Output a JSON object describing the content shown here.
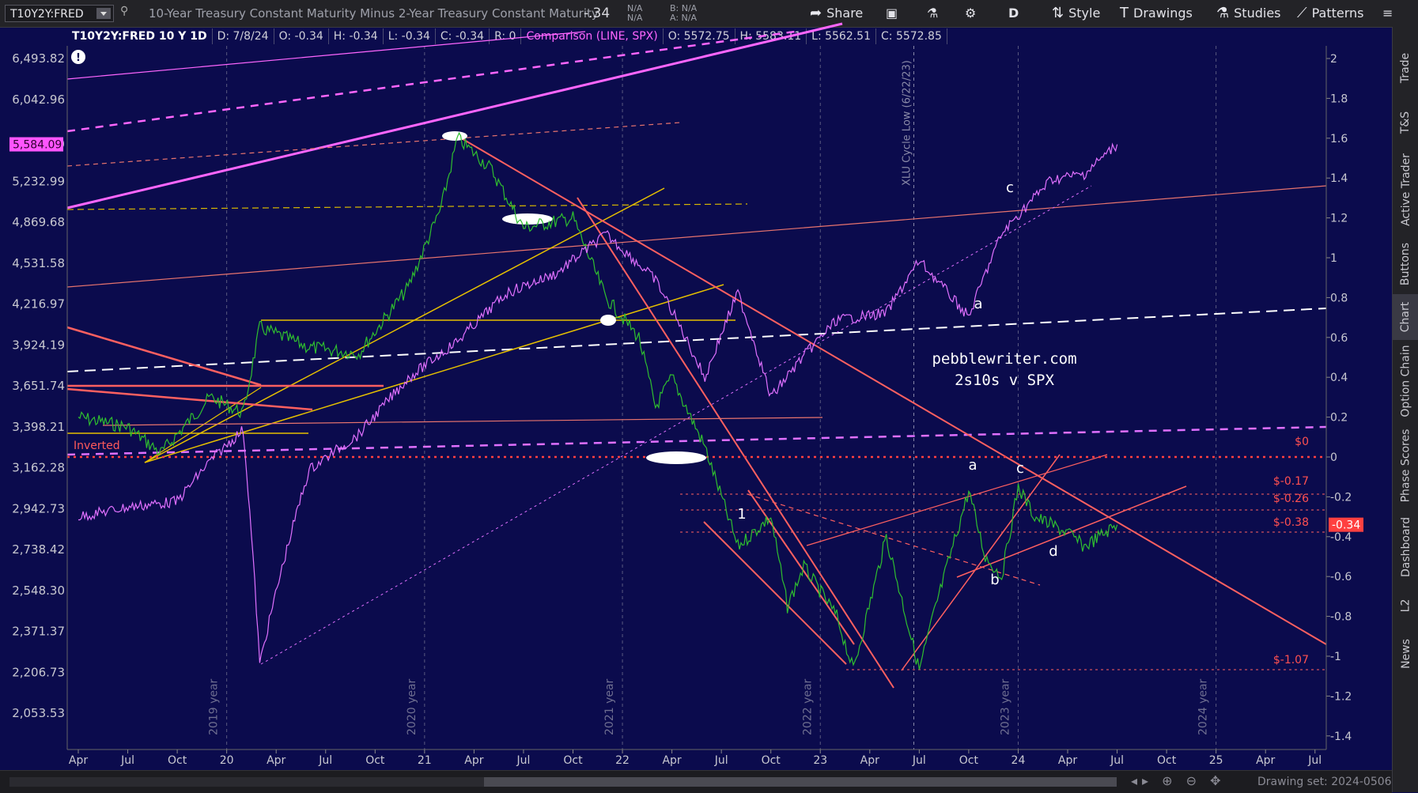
{
  "toolbar": {
    "symbol": "T10Y2Y:FRED",
    "description": "10-Year Treasury Constant Maturity Minus 2-Year Treasury Constant Maturity",
    "change": "-.34",
    "bid_na": "N/A",
    "ask_na": "N/A",
    "bid_label": "B: N/A",
    "ask_label": "A: N/A",
    "share": "Share",
    "timeframe": "D",
    "style": "Style",
    "drawings": "Drawings",
    "studies": "Studies",
    "patterns": "Patterns"
  },
  "legend": {
    "symbol": "T10Y2Y:FRED 10 Y 1D",
    "date": "D: 7/8/24",
    "open": "O: -0.34",
    "high": "H: -0.34",
    "low": "L: -0.34",
    "close": "C: -0.34",
    "r": "R: 0",
    "comparison": "Comparison (LINE, SPX)",
    "cmp_open": "O: 5572.75",
    "cmp_high": "H: 5583.11",
    "cmp_low": "L: 5562.51",
    "cmp_close": "C: 5572.85"
  },
  "sidebar_tabs": [
    "Trade",
    "T&S",
    "Active Trader",
    "Buttons",
    "Chart",
    "Option Chain",
    "Phase Scores",
    "Dashboard",
    "L2",
    "News"
  ],
  "sidebar_active": "Chart",
  "bottom": {
    "drawing_set": "Drawing set: 2024-0506"
  },
  "chart_data": {
    "type": "line",
    "title": "pebblewriter.com 2s10s v SPX",
    "left_axis": {
      "label": "SPX",
      "ticks": [
        6493.82,
        6042.96,
        5584.09,
        5232.99,
        4869.68,
        4531.58,
        4216.97,
        3924.19,
        3651.74,
        3398.21,
        3162.28,
        2942.73,
        2738.42,
        2548.3,
        2371.37,
        2206.73,
        2053.53
      ],
      "scale": "log",
      "current_marker": 5584.09
    },
    "right_axis": {
      "label": "T10Y2Y",
      "ticks": [
        2,
        1.8,
        1.6,
        1.4,
        1.2,
        1,
        0.8,
        0.6,
        0.4,
        0.2,
        0,
        -0.2,
        -0.4,
        -0.6,
        -0.8,
        -1,
        -1.2,
        -1.4
      ],
      "range": [
        -1.45,
        2.05
      ],
      "current_marker": -0.34
    },
    "x_axis": {
      "ticks": [
        "Apr",
        "Jul",
        "Oct",
        "20",
        "Apr",
        "Jul",
        "Oct",
        "21",
        "Apr",
        "Jul",
        "Oct",
        "22",
        "Apr",
        "Jul",
        "Oct",
        "23",
        "Apr",
        "Jul",
        "Oct",
        "24",
        "Apr",
        "Jul",
        "Oct",
        "25",
        "Apr",
        "Jul"
      ],
      "year_markers": [
        "2019 year",
        "2020 year",
        "2021 year",
        "2022 year",
        "2023 year",
        "2024 year"
      ]
    },
    "series": [
      {
        "name": "T10Y2Y:FRED",
        "color": "#2fbf2f",
        "x": [
          "2019-04",
          "2019-07",
          "2019-09",
          "2019-12",
          "2020-02",
          "2020-03",
          "2020-06",
          "2020-09",
          "2020-12",
          "2021-02",
          "2021-03",
          "2021-05",
          "2021-07",
          "2021-10",
          "2021-12",
          "2022-02",
          "2022-03",
          "2022-04",
          "2022-06",
          "2022-07",
          "2022-08",
          "2022-10",
          "2022-11",
          "2022-12",
          "2023-02",
          "2023-03",
          "2023-05",
          "2023-07",
          "2023-08",
          "2023-10",
          "2023-11",
          "2023-12",
          "2024-01",
          "2024-02",
          "2024-04",
          "2024-05",
          "2024-07"
        ],
        "values": [
          0.2,
          0.15,
          0.02,
          0.3,
          0.22,
          0.65,
          0.55,
          0.52,
          0.85,
          1.25,
          1.6,
          1.45,
          1.15,
          1.2,
          0.8,
          0.6,
          0.25,
          0.4,
          0.05,
          -0.2,
          -0.45,
          -0.3,
          -0.75,
          -0.55,
          -0.8,
          -1.07,
          -0.4,
          -1.07,
          -0.75,
          -0.17,
          -0.5,
          -0.6,
          -0.15,
          -0.3,
          -0.38,
          -0.45,
          -0.34
        ]
      },
      {
        "name": "SPX",
        "color": "#e070ff",
        "x": [
          "2019-04",
          "2019-07",
          "2019-10",
          "2019-12",
          "2020-02",
          "2020-03",
          "2020-06",
          "2020-09",
          "2020-12",
          "2021-03",
          "2021-06",
          "2021-09",
          "2021-12",
          "2022-03",
          "2022-06",
          "2022-08",
          "2022-10",
          "2022-12",
          "2023-02",
          "2023-05",
          "2023-07",
          "2023-10",
          "2023-12",
          "2024-03",
          "2024-05",
          "2024-07"
        ],
        "values": [
          2900,
          2950,
          2980,
          3200,
          3380,
          2237,
          3150,
          3350,
          3700,
          3950,
          4300,
          4450,
          4766,
          4400,
          3700,
          4300,
          3577,
          3850,
          4100,
          4150,
          4550,
          4120,
          4770,
          5250,
          5300,
          5584
        ]
      }
    ],
    "annotations": [
      "Inverted",
      "$0",
      "$-0.17",
      "$-0.26",
      "$-0.38",
      "$-1.07",
      "XLU Cycle Low (6/22/23)",
      "a",
      "b",
      "c",
      "d",
      "1"
    ],
    "grid": true
  }
}
